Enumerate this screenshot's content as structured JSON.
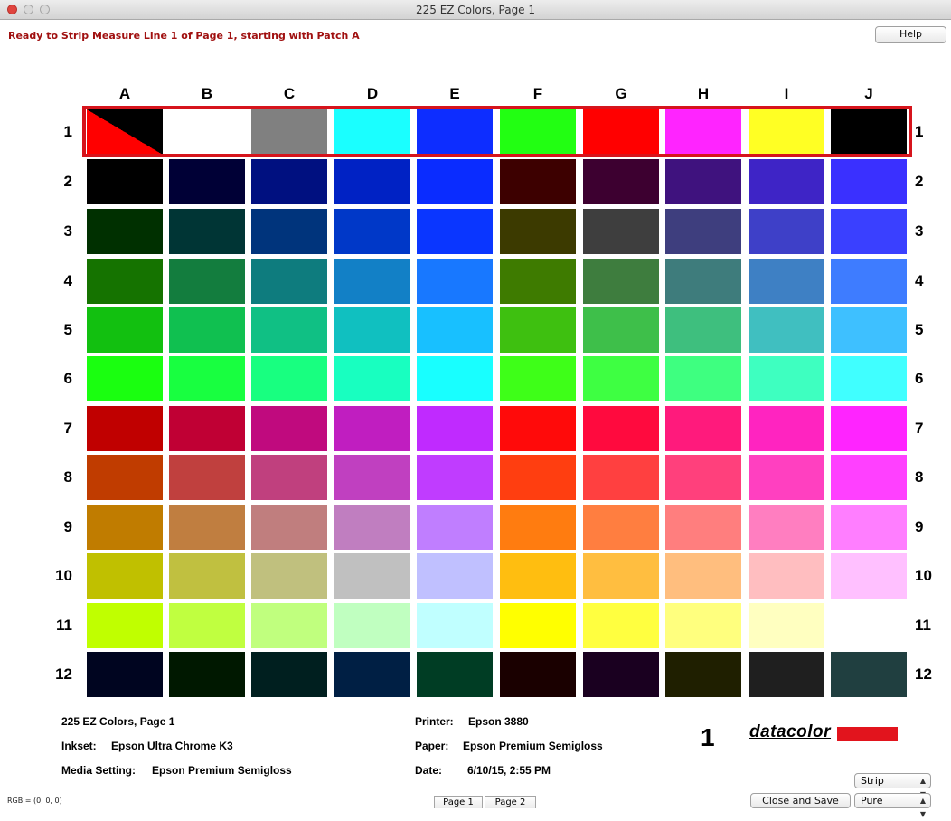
{
  "window": {
    "title": "225 EZ Colors, Page 1"
  },
  "status_message": "Ready to Strip Measure Line 1 of Page 1, starting with Patch A",
  "buttons": {
    "help": "Help",
    "close_and_save": "Close and Save"
  },
  "columns": [
    "A",
    "B",
    "C",
    "D",
    "E",
    "F",
    "G",
    "H",
    "I",
    "J"
  ],
  "rows": [
    "1",
    "2",
    "3",
    "4",
    "5",
    "6",
    "7",
    "8",
    "9",
    "10",
    "11",
    "12"
  ],
  "patches": [
    [
      "#000000",
      "#ffffff",
      "#808080",
      "#1affff",
      "#0d2dff",
      "#22ff12",
      "#ff0000",
      "#ff24ff",
      "#ffff24",
      "#000000"
    ],
    [
      "#000000",
      "#000036",
      "#001080",
      "#0022c4",
      "#0a2cff",
      "#3d0000",
      "#3d0030",
      "#3f127e",
      "#3e24c6",
      "#3a30ff"
    ],
    [
      "#003000",
      "#003535",
      "#00347c",
      "#0038c8",
      "#0a36ff",
      "#3c3a00",
      "#3e3e3e",
      "#3e3e7e",
      "#3e40c8",
      "#3a40ff"
    ],
    [
      "#157300",
      "#137d3e",
      "#0e7c7e",
      "#1280c6",
      "#1878ff",
      "#3e7b00",
      "#3e7d3e",
      "#3e7c7c",
      "#3e80c4",
      "#3e7cff"
    ],
    [
      "#12c010",
      "#10c050",
      "#10c084",
      "#10c0c0",
      "#18c0ff",
      "#3ec010",
      "#3ebf4a",
      "#3ebf7e",
      "#40bfc0",
      "#3ec0ff"
    ],
    [
      "#1aff10",
      "#18ff40",
      "#18ff80",
      "#18ffc0",
      "#18ffff",
      "#3eff18",
      "#3eff42",
      "#3eff80",
      "#3effc0",
      "#40ffff"
    ],
    [
      "#c00000",
      "#c00034",
      "#c00a7e",
      "#c01ec0",
      "#c02aff",
      "#ff0a0a",
      "#ff0a3e",
      "#ff1a7c",
      "#ff24c0",
      "#ff24ff"
    ],
    [
      "#c03c00",
      "#c0403e",
      "#c0407e",
      "#c040c0",
      "#c03cff",
      "#ff3e10",
      "#ff4040",
      "#ff407c",
      "#ff40c0",
      "#ff40ff"
    ],
    [
      "#c07c00",
      "#c07e40",
      "#c07e7e",
      "#c07ec0",
      "#c07eff",
      "#ff7c10",
      "#ff7e40",
      "#ff7e7e",
      "#ff7ec0",
      "#ff7eff"
    ],
    [
      "#c0c000",
      "#c0c040",
      "#c0c07e",
      "#c0c0c0",
      "#c0c0ff",
      "#ffbe10",
      "#ffbe40",
      "#ffbe7e",
      "#ffbec0",
      "#ffc0ff"
    ],
    [
      "#c0ff00",
      "#c0ff40",
      "#c0ff7e",
      "#c0ffc0",
      "#c0ffff",
      "#ffff00",
      "#ffff40",
      "#ffff7e",
      "#ffffc0",
      "#ffffff"
    ],
    [
      "#000520",
      "#001800",
      "#001f1f",
      "#001f44",
      "#003d24",
      "#1a0000",
      "#1a0020",
      "#1f1f00",
      "#1f1f1f",
      "#203f40"
    ]
  ],
  "highlight_color": "#d6141c",
  "info": {
    "chart_name": "225 EZ Colors, Page 1",
    "inkset_label": "Inkset:",
    "inkset_value": "Epson Ultra Chrome K3",
    "media_label": "Media Setting:",
    "media_value": "Epson Premium Semigloss",
    "printer_label": "Printer:",
    "printer_value": "Epson 3880",
    "paper_label": "Paper:",
    "paper_value": "Epson Premium Semigloss",
    "date_label": "Date:",
    "date_value": "6/10/15, 2:55 PM"
  },
  "page_number": "1",
  "logo_text": "datacolor",
  "logo_color": "#e2141d",
  "rgb_readout": "RGB = (0, 0, 0)",
  "page_tabs": [
    "Page 1",
    "Page 2"
  ],
  "measure_mode": "Strip",
  "ink_mode": "Pure"
}
